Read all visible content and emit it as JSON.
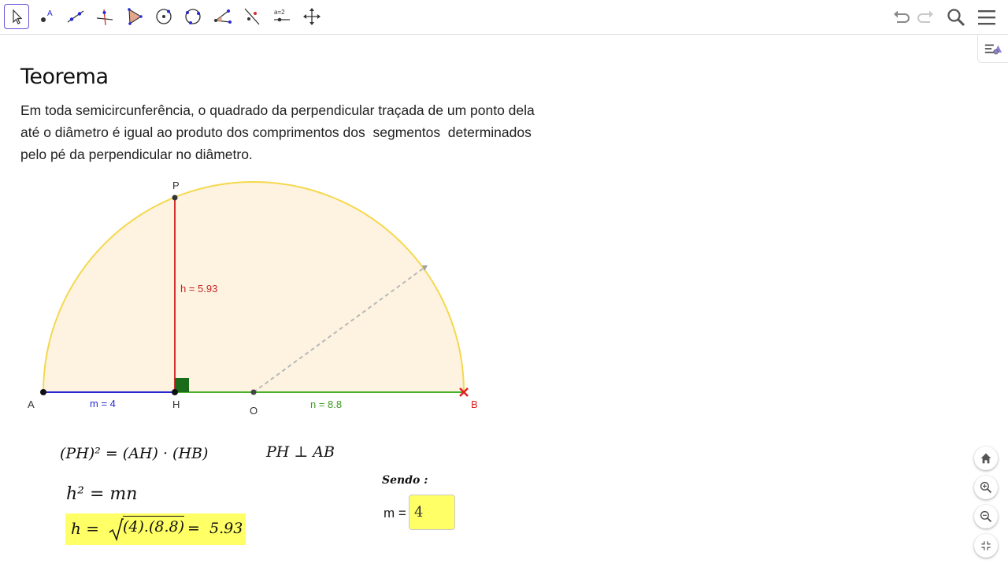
{
  "toolbar": {
    "tools": [
      {
        "icon": "move-arrow-icon",
        "active": true
      },
      {
        "icon": "point-icon"
      },
      {
        "icon": "line-icon"
      },
      {
        "icon": "perpendicular-line-icon"
      },
      {
        "icon": "polygon-icon"
      },
      {
        "icon": "circle-center-point-icon"
      },
      {
        "icon": "circle-three-points-icon"
      },
      {
        "icon": "angle-icon"
      },
      {
        "icon": "reflect-about-line-icon"
      },
      {
        "icon": "slider-icon",
        "label": "a=2"
      },
      {
        "icon": "move-graphics-view-icon"
      }
    ],
    "right": [
      "undo-icon",
      "redo-icon",
      "search-icon",
      "menu-icon"
    ]
  },
  "content": {
    "title": "Teorema",
    "theorem_lines": [
      "Em toda semicircunferência, o quadrado da perpendicular traçada de um ponto dela",
      "até o diâmetro é igual ao produto dos comprimentos dos  segmentos  determinados",
      "pelo pé da perpendicular no diâmetro."
    ]
  },
  "figure": {
    "points": {
      "A": "A",
      "H": "H",
      "O": "O",
      "B": "B",
      "P": "P"
    },
    "labels": {
      "h": "h = 5.93",
      "m": "m = 4",
      "n": "n = 8.8"
    },
    "colors": {
      "semicircle": "#f5d84e",
      "fill": "#fdf3e0",
      "h_segment": "#d32f2f",
      "m_segment": "#2929d4",
      "n_segment": "#4caf2a",
      "right_angle": "#1a6b1a",
      "radius_dashed": "#b8b8b8",
      "B_marker": "#e02020",
      "highlight": "#ffff66"
    }
  },
  "formulas": {
    "f1": "(PH)² = (AH) · (HB)",
    "f2": "PH ⊥ AB",
    "f3": "h² = mn",
    "f4_left": "h =",
    "f4_sqrt": "(4).(8.8)",
    "f4_right": "=  5.93",
    "sendo": "Sendo :",
    "m_label": "m =",
    "m_value": "4"
  },
  "nav": [
    "home-icon",
    "zoom-in-icon",
    "zoom-out-icon",
    "exit-fullscreen-icon"
  ]
}
